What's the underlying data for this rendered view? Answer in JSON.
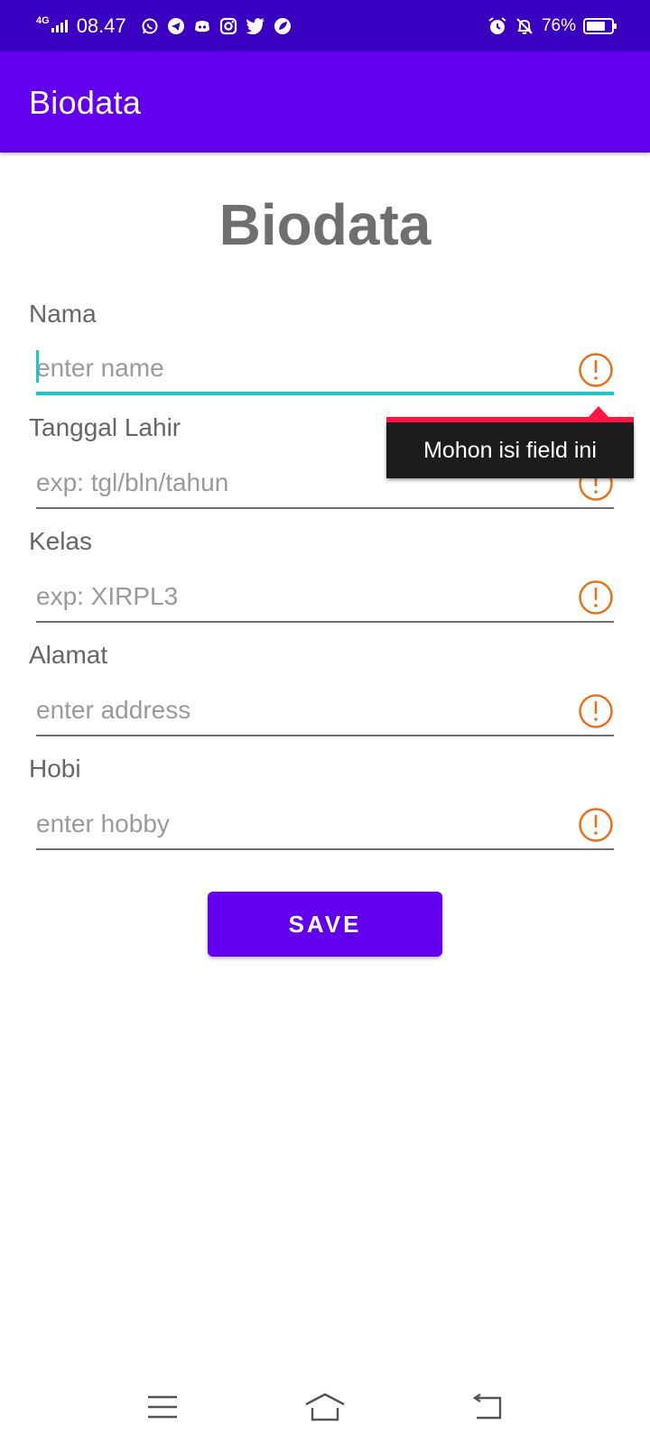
{
  "status_bar": {
    "network_type": "4G",
    "time": "08.47",
    "notification_icons": [
      "whatsapp-icon",
      "telegram-icon",
      "discord-icon",
      "instagram-icon",
      "twitter-icon",
      "leaf-app-icon"
    ],
    "battery_percent": "76%",
    "battery_level": 0.76,
    "right_icons": [
      "alarm-icon",
      "mute-bell-icon"
    ]
  },
  "app_bar": {
    "title": "Biodata",
    "color": "#6200ee"
  },
  "page": {
    "heading": "Biodata"
  },
  "form": {
    "fields": [
      {
        "label": "Nama",
        "placeholder": "enter name",
        "value": ""
      },
      {
        "label": "Tanggal Lahir",
        "placeholder": "exp: tgl/bln/tahun",
        "value": ""
      },
      {
        "label": "Kelas",
        "placeholder": "exp: XIRPL3",
        "value": ""
      },
      {
        "label": "Alamat",
        "placeholder": "enter address",
        "value": ""
      },
      {
        "label": "Hobi",
        "placeholder": "enter hobby",
        "value": ""
      }
    ],
    "error_tooltip": "Mohon isi field ini",
    "error_icon": "exclamation-circle-icon",
    "error_color": "#e8711b",
    "focus_color": "#1bc8c2"
  },
  "save_button": {
    "label": "SAVE"
  },
  "nav_bar": {
    "icons": [
      "menu-icon",
      "home-icon",
      "back-icon"
    ]
  }
}
